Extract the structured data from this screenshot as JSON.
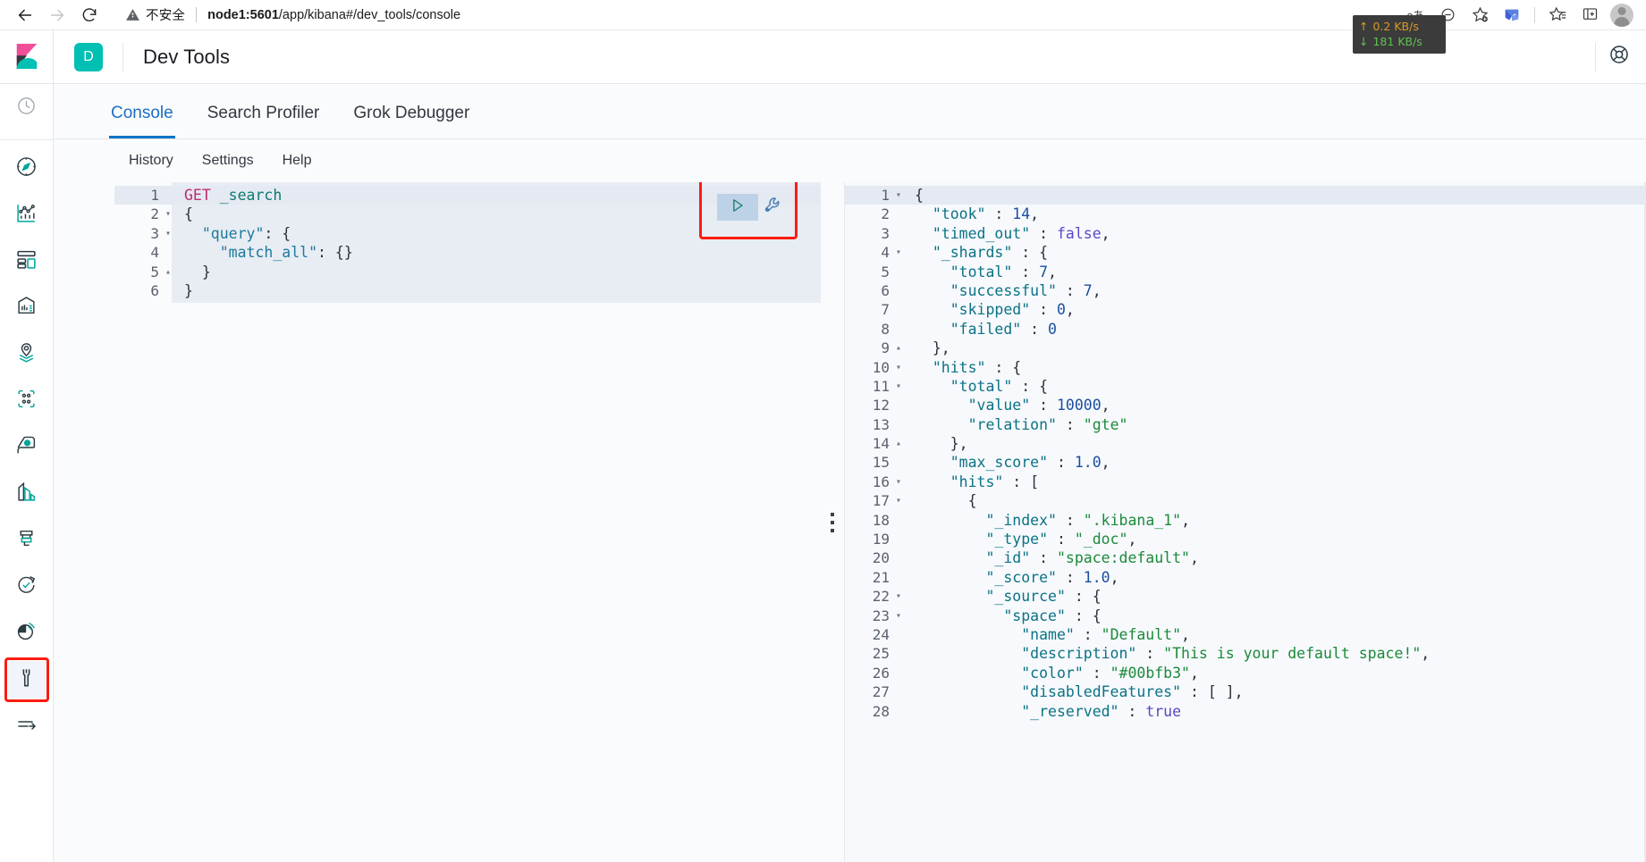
{
  "browser": {
    "back_label": "back",
    "forward_label": "forward",
    "reload_label": "reload",
    "security_label": "不安全",
    "url_host": "node1:5601",
    "url_path": "/app/kibana#/dev_tools/console",
    "aa_label": "aあ",
    "zoom_icon": "zoom-out-icon",
    "favorite_icon": "star-add-icon",
    "collections_icon": "collections-icon",
    "favorites_bar_icon": "favorites-list-icon",
    "split_screen_icon": "split-screen-icon",
    "profile_icon": "profile-avatar"
  },
  "network_monitor": {
    "upload": "0.2 KB/s",
    "download": "181 KB/s",
    "upload_arrow": "↑",
    "download_arrow": "↓"
  },
  "sidebar": {
    "logo": "kibana-logo",
    "items": [
      {
        "name": "recently-viewed",
        "icon": "clock-icon",
        "selected": false
      },
      {
        "name": "discover",
        "icon": "compass-icon",
        "selected": false
      },
      {
        "name": "visualize",
        "icon": "visualize-chart-icon",
        "selected": false
      },
      {
        "name": "dashboard",
        "icon": "dashboard-grid-icon",
        "selected": false
      },
      {
        "name": "canvas",
        "icon": "canvas-presentation-icon",
        "selected": false
      },
      {
        "name": "maps",
        "icon": "map-marker-layers-icon",
        "selected": false
      },
      {
        "name": "graph",
        "icon": "graph-nodes-icon",
        "selected": false
      },
      {
        "name": "machine-learning",
        "icon": "ml-icon",
        "selected": false
      },
      {
        "name": "infrastructure",
        "icon": "infrastructure-icon",
        "selected": false
      },
      {
        "name": "logs",
        "icon": "logs-icon",
        "selected": false
      },
      {
        "name": "apm",
        "icon": "apm-clock-icon",
        "selected": false
      },
      {
        "name": "uptime",
        "icon": "uptime-signal-icon",
        "selected": false
      },
      {
        "name": "dev-tools",
        "icon": "wrench-icon",
        "selected": true
      },
      {
        "name": "collapse-nav",
        "icon": "collapse-arrow-icon",
        "selected": false
      }
    ]
  },
  "header": {
    "space_initial": "D",
    "title": "Dev Tools",
    "help_icon": "lifebuoy-help-icon"
  },
  "tabs": [
    {
      "label": "Console",
      "active": true
    },
    {
      "label": "Search Profiler",
      "active": false
    },
    {
      "label": "Grok Debugger",
      "active": false
    }
  ],
  "menu": [
    {
      "label": "History"
    },
    {
      "label": "Settings"
    },
    {
      "label": "Help"
    }
  ],
  "console": {
    "run_button_icon": "play-triangle-icon",
    "wrench_button_icon": "wrench-settings-icon",
    "drag_handle_icon": "drag-handle-dots-icon",
    "annotation_color": "#fc1c12",
    "request": {
      "lines": [
        {
          "n": 1,
          "fold": "",
          "highlight": true,
          "tokens": [
            {
              "t": "GET",
              "c": "t-method"
            },
            {
              "t": " ",
              "c": "t-plain"
            },
            {
              "t": "_search",
              "c": "t-url"
            }
          ]
        },
        {
          "n": 2,
          "fold": "▾",
          "highlight": false,
          "tokens": [
            {
              "t": "{",
              "c": "t-punct"
            }
          ]
        },
        {
          "n": 3,
          "fold": "▾",
          "highlight": false,
          "tokens": [
            {
              "t": "  ",
              "c": "t-plain"
            },
            {
              "t": "\"query\"",
              "c": "t-key"
            },
            {
              "t": ": {",
              "c": "t-punct"
            }
          ]
        },
        {
          "n": 4,
          "fold": "",
          "highlight": false,
          "tokens": [
            {
              "t": "    ",
              "c": "t-plain"
            },
            {
              "t": "\"match_all\"",
              "c": "t-key"
            },
            {
              "t": ": {}",
              "c": "t-punct"
            }
          ]
        },
        {
          "n": 5,
          "fold": "▴",
          "highlight": false,
          "tokens": [
            {
              "t": "  }",
              "c": "t-punct"
            }
          ]
        },
        {
          "n": 6,
          "fold": "",
          "highlight": false,
          "tokens": [
            {
              "t": "}",
              "c": "t-punct"
            }
          ]
        }
      ]
    },
    "response": {
      "lines": [
        {
          "n": 1,
          "fold": "▾",
          "highlight": true,
          "tokens": [
            {
              "t": "{",
              "c": "t-punct"
            }
          ]
        },
        {
          "n": 2,
          "fold": "",
          "highlight": false,
          "tokens": [
            {
              "t": "  ",
              "c": "t-plain"
            },
            {
              "t": "\"took\"",
              "c": "t-keyd"
            },
            {
              "t": " : ",
              "c": "t-punct"
            },
            {
              "t": "14",
              "c": "t-num"
            },
            {
              "t": ",",
              "c": "t-punct"
            }
          ]
        },
        {
          "n": 3,
          "fold": "",
          "highlight": false,
          "tokens": [
            {
              "t": "  ",
              "c": "t-plain"
            },
            {
              "t": "\"timed_out\"",
              "c": "t-keyd"
            },
            {
              "t": " : ",
              "c": "t-punct"
            },
            {
              "t": "false",
              "c": "t-bool"
            },
            {
              "t": ",",
              "c": "t-punct"
            }
          ]
        },
        {
          "n": 4,
          "fold": "▾",
          "highlight": false,
          "tokens": [
            {
              "t": "  ",
              "c": "t-plain"
            },
            {
              "t": "\"_shards\"",
              "c": "t-keyd"
            },
            {
              "t": " : {",
              "c": "t-punct"
            }
          ]
        },
        {
          "n": 5,
          "fold": "",
          "highlight": false,
          "tokens": [
            {
              "t": "    ",
              "c": "t-plain"
            },
            {
              "t": "\"total\"",
              "c": "t-keyd"
            },
            {
              "t": " : ",
              "c": "t-punct"
            },
            {
              "t": "7",
              "c": "t-num"
            },
            {
              "t": ",",
              "c": "t-punct"
            }
          ]
        },
        {
          "n": 6,
          "fold": "",
          "highlight": false,
          "tokens": [
            {
              "t": "    ",
              "c": "t-plain"
            },
            {
              "t": "\"successful\"",
              "c": "t-keyd"
            },
            {
              "t": " : ",
              "c": "t-punct"
            },
            {
              "t": "7",
              "c": "t-num"
            },
            {
              "t": ",",
              "c": "t-punct"
            }
          ]
        },
        {
          "n": 7,
          "fold": "",
          "highlight": false,
          "tokens": [
            {
              "t": "    ",
              "c": "t-plain"
            },
            {
              "t": "\"skipped\"",
              "c": "t-keyd"
            },
            {
              "t": " : ",
              "c": "t-punct"
            },
            {
              "t": "0",
              "c": "t-num"
            },
            {
              "t": ",",
              "c": "t-punct"
            }
          ]
        },
        {
          "n": 8,
          "fold": "",
          "highlight": false,
          "tokens": [
            {
              "t": "    ",
              "c": "t-plain"
            },
            {
              "t": "\"failed\"",
              "c": "t-keyd"
            },
            {
              "t": " : ",
              "c": "t-punct"
            },
            {
              "t": "0",
              "c": "t-num"
            }
          ]
        },
        {
          "n": 9,
          "fold": "▴",
          "highlight": false,
          "tokens": [
            {
              "t": "  },",
              "c": "t-punct"
            }
          ]
        },
        {
          "n": 10,
          "fold": "▾",
          "highlight": false,
          "tokens": [
            {
              "t": "  ",
              "c": "t-plain"
            },
            {
              "t": "\"hits\"",
              "c": "t-keyd"
            },
            {
              "t": " : {",
              "c": "t-punct"
            }
          ]
        },
        {
          "n": 11,
          "fold": "▾",
          "highlight": false,
          "tokens": [
            {
              "t": "    ",
              "c": "t-plain"
            },
            {
              "t": "\"total\"",
              "c": "t-keyd"
            },
            {
              "t": " : {",
              "c": "t-punct"
            }
          ]
        },
        {
          "n": 12,
          "fold": "",
          "highlight": false,
          "tokens": [
            {
              "t": "      ",
              "c": "t-plain"
            },
            {
              "t": "\"value\"",
              "c": "t-keyd"
            },
            {
              "t": " : ",
              "c": "t-punct"
            },
            {
              "t": "10000",
              "c": "t-num"
            },
            {
              "t": ",",
              "c": "t-punct"
            }
          ]
        },
        {
          "n": 13,
          "fold": "",
          "highlight": false,
          "tokens": [
            {
              "t": "      ",
              "c": "t-plain"
            },
            {
              "t": "\"relation\"",
              "c": "t-keyd"
            },
            {
              "t": " : ",
              "c": "t-punct"
            },
            {
              "t": "\"gte\"",
              "c": "t-str"
            }
          ]
        },
        {
          "n": 14,
          "fold": "▴",
          "highlight": false,
          "tokens": [
            {
              "t": "    },",
              "c": "t-punct"
            }
          ]
        },
        {
          "n": 15,
          "fold": "",
          "highlight": false,
          "tokens": [
            {
              "t": "    ",
              "c": "t-plain"
            },
            {
              "t": "\"max_score\"",
              "c": "t-keyd"
            },
            {
              "t": " : ",
              "c": "t-punct"
            },
            {
              "t": "1.0",
              "c": "t-num"
            },
            {
              "t": ",",
              "c": "t-punct"
            }
          ]
        },
        {
          "n": 16,
          "fold": "▾",
          "highlight": false,
          "tokens": [
            {
              "t": "    ",
              "c": "t-plain"
            },
            {
              "t": "\"hits\"",
              "c": "t-keyd"
            },
            {
              "t": " : [",
              "c": "t-punct"
            }
          ]
        },
        {
          "n": 17,
          "fold": "▾",
          "highlight": false,
          "tokens": [
            {
              "t": "      {",
              "c": "t-punct"
            }
          ]
        },
        {
          "n": 18,
          "fold": "",
          "highlight": false,
          "tokens": [
            {
              "t": "        ",
              "c": "t-plain"
            },
            {
              "t": "\"_index\"",
              "c": "t-keyd"
            },
            {
              "t": " : ",
              "c": "t-punct"
            },
            {
              "t": "\".kibana_1\"",
              "c": "t-str"
            },
            {
              "t": ",",
              "c": "t-punct"
            }
          ]
        },
        {
          "n": 19,
          "fold": "",
          "highlight": false,
          "tokens": [
            {
              "t": "        ",
              "c": "t-plain"
            },
            {
              "t": "\"_type\"",
              "c": "t-keyd"
            },
            {
              "t": " : ",
              "c": "t-punct"
            },
            {
              "t": "\"_doc\"",
              "c": "t-str"
            },
            {
              "t": ",",
              "c": "t-punct"
            }
          ]
        },
        {
          "n": 20,
          "fold": "",
          "highlight": false,
          "tokens": [
            {
              "t": "        ",
              "c": "t-plain"
            },
            {
              "t": "\"_id\"",
              "c": "t-keyd"
            },
            {
              "t": " : ",
              "c": "t-punct"
            },
            {
              "t": "\"space:default\"",
              "c": "t-str"
            },
            {
              "t": ",",
              "c": "t-punct"
            }
          ]
        },
        {
          "n": 21,
          "fold": "",
          "highlight": false,
          "tokens": [
            {
              "t": "        ",
              "c": "t-plain"
            },
            {
              "t": "\"_score\"",
              "c": "t-keyd"
            },
            {
              "t": " : ",
              "c": "t-punct"
            },
            {
              "t": "1.0",
              "c": "t-num"
            },
            {
              "t": ",",
              "c": "t-punct"
            }
          ]
        },
        {
          "n": 22,
          "fold": "▾",
          "highlight": false,
          "tokens": [
            {
              "t": "        ",
              "c": "t-plain"
            },
            {
              "t": "\"_source\"",
              "c": "t-keyd"
            },
            {
              "t": " : {",
              "c": "t-punct"
            }
          ]
        },
        {
          "n": 23,
          "fold": "▾",
          "highlight": false,
          "tokens": [
            {
              "t": "          ",
              "c": "t-plain"
            },
            {
              "t": "\"space\"",
              "c": "t-keyd"
            },
            {
              "t": " : {",
              "c": "t-punct"
            }
          ]
        },
        {
          "n": 24,
          "fold": "",
          "highlight": false,
          "tokens": [
            {
              "t": "            ",
              "c": "t-plain"
            },
            {
              "t": "\"name\"",
              "c": "t-keyd"
            },
            {
              "t": " : ",
              "c": "t-punct"
            },
            {
              "t": "\"Default\"",
              "c": "t-str"
            },
            {
              "t": ",",
              "c": "t-punct"
            }
          ]
        },
        {
          "n": 25,
          "fold": "",
          "highlight": false,
          "tokens": [
            {
              "t": "            ",
              "c": "t-plain"
            },
            {
              "t": "\"description\"",
              "c": "t-keyd"
            },
            {
              "t": " : ",
              "c": "t-punct"
            },
            {
              "t": "\"This is your default space!\"",
              "c": "t-str"
            },
            {
              "t": ",",
              "c": "t-punct"
            }
          ]
        },
        {
          "n": 26,
          "fold": "",
          "highlight": false,
          "tokens": [
            {
              "t": "            ",
              "c": "t-plain"
            },
            {
              "t": "\"color\"",
              "c": "t-keyd"
            },
            {
              "t": " : ",
              "c": "t-punct"
            },
            {
              "t": "\"#00bfb3\"",
              "c": "t-str"
            },
            {
              "t": ",",
              "c": "t-punct"
            }
          ]
        },
        {
          "n": 27,
          "fold": "",
          "highlight": false,
          "tokens": [
            {
              "t": "            ",
              "c": "t-plain"
            },
            {
              "t": "\"disabledFeatures\"",
              "c": "t-keyd"
            },
            {
              "t": " : [ ],",
              "c": "t-punct"
            }
          ]
        },
        {
          "n": 28,
          "fold": "",
          "highlight": false,
          "tokens": [
            {
              "t": "            ",
              "c": "t-plain"
            },
            {
              "t": "\"_reserved\"",
              "c": "t-keyd"
            },
            {
              "t": " : ",
              "c": "t-punct"
            },
            {
              "t": "true",
              "c": "t-bool"
            }
          ]
        }
      ]
    }
  }
}
